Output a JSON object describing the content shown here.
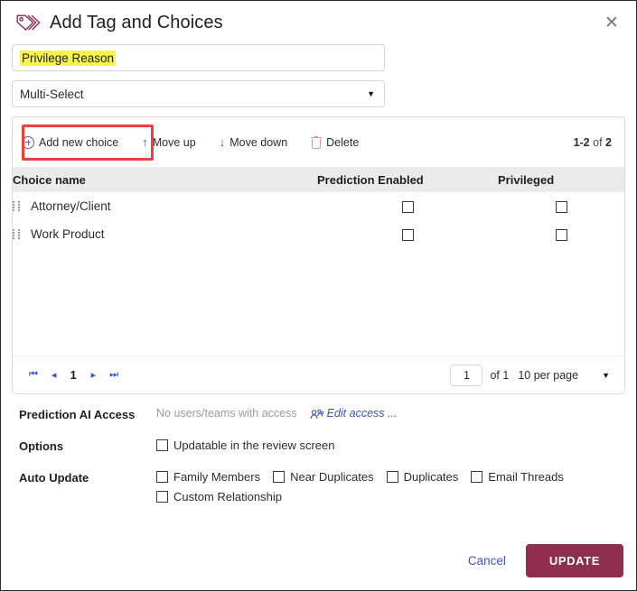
{
  "header": {
    "title": "Add Tag and Choices",
    "icon": "tag-icon",
    "close_label": "✕"
  },
  "form_top": {
    "tag_name_value": "Privilege Reason",
    "tag_name_placeholder": "",
    "tag_type_value": "Multi-Select",
    "caret": "▼"
  },
  "toolbar": {
    "add_choice_label": "Add new choice",
    "move_up_label": "Move up",
    "move_up_glyph": "↑",
    "move_down_label": "Move down",
    "move_down_glyph": "↓",
    "delete_label": "Delete",
    "counter_range": "1-2",
    "counter_of": "of",
    "counter_total": "2"
  },
  "grid": {
    "columns": [
      "Choice name",
      "Prediction Enabled",
      "Privileged"
    ],
    "rows": [
      {
        "name": "Attorney/Client",
        "prediction_enabled": false,
        "privileged": false
      },
      {
        "name": "Work Product",
        "prediction_enabled": false,
        "privileged": false
      }
    ]
  },
  "pager": {
    "first_glyph": "⏮",
    "prev_glyph": "◂",
    "page_number": "1",
    "next_glyph": "▸",
    "last_glyph": "⏭",
    "page_input_value": "1",
    "of_text": "of 1",
    "page_size": "10 per page",
    "caret": "▼"
  },
  "sections": {
    "prediction_access": {
      "label": "Prediction AI Access",
      "value": "No users/teams with access",
      "edit_link": "Edit access ..."
    },
    "options": {
      "label": "Options",
      "items": [
        {
          "label": "Updatable in the review screen",
          "checked": false
        }
      ]
    },
    "auto_update": {
      "label": "Auto Update",
      "items_row1": [
        {
          "label": "Family Members",
          "checked": false
        },
        {
          "label": "Near Duplicates",
          "checked": false
        },
        {
          "label": "Duplicates",
          "checked": false
        },
        {
          "label": "Email Threads",
          "checked": false
        }
      ],
      "items_row2": [
        {
          "label": "Custom Relationship",
          "checked": false
        }
      ]
    }
  },
  "footer": {
    "cancel_label": "Cancel",
    "update_label": "UPDATE"
  },
  "colors": {
    "accent_maroon": "#8e2f4f",
    "link_blue": "#3b54c4",
    "highlight_yellow": "#faf34a",
    "annotation_red": "#ef3e3e",
    "header_gray": "#ebebeb"
  }
}
